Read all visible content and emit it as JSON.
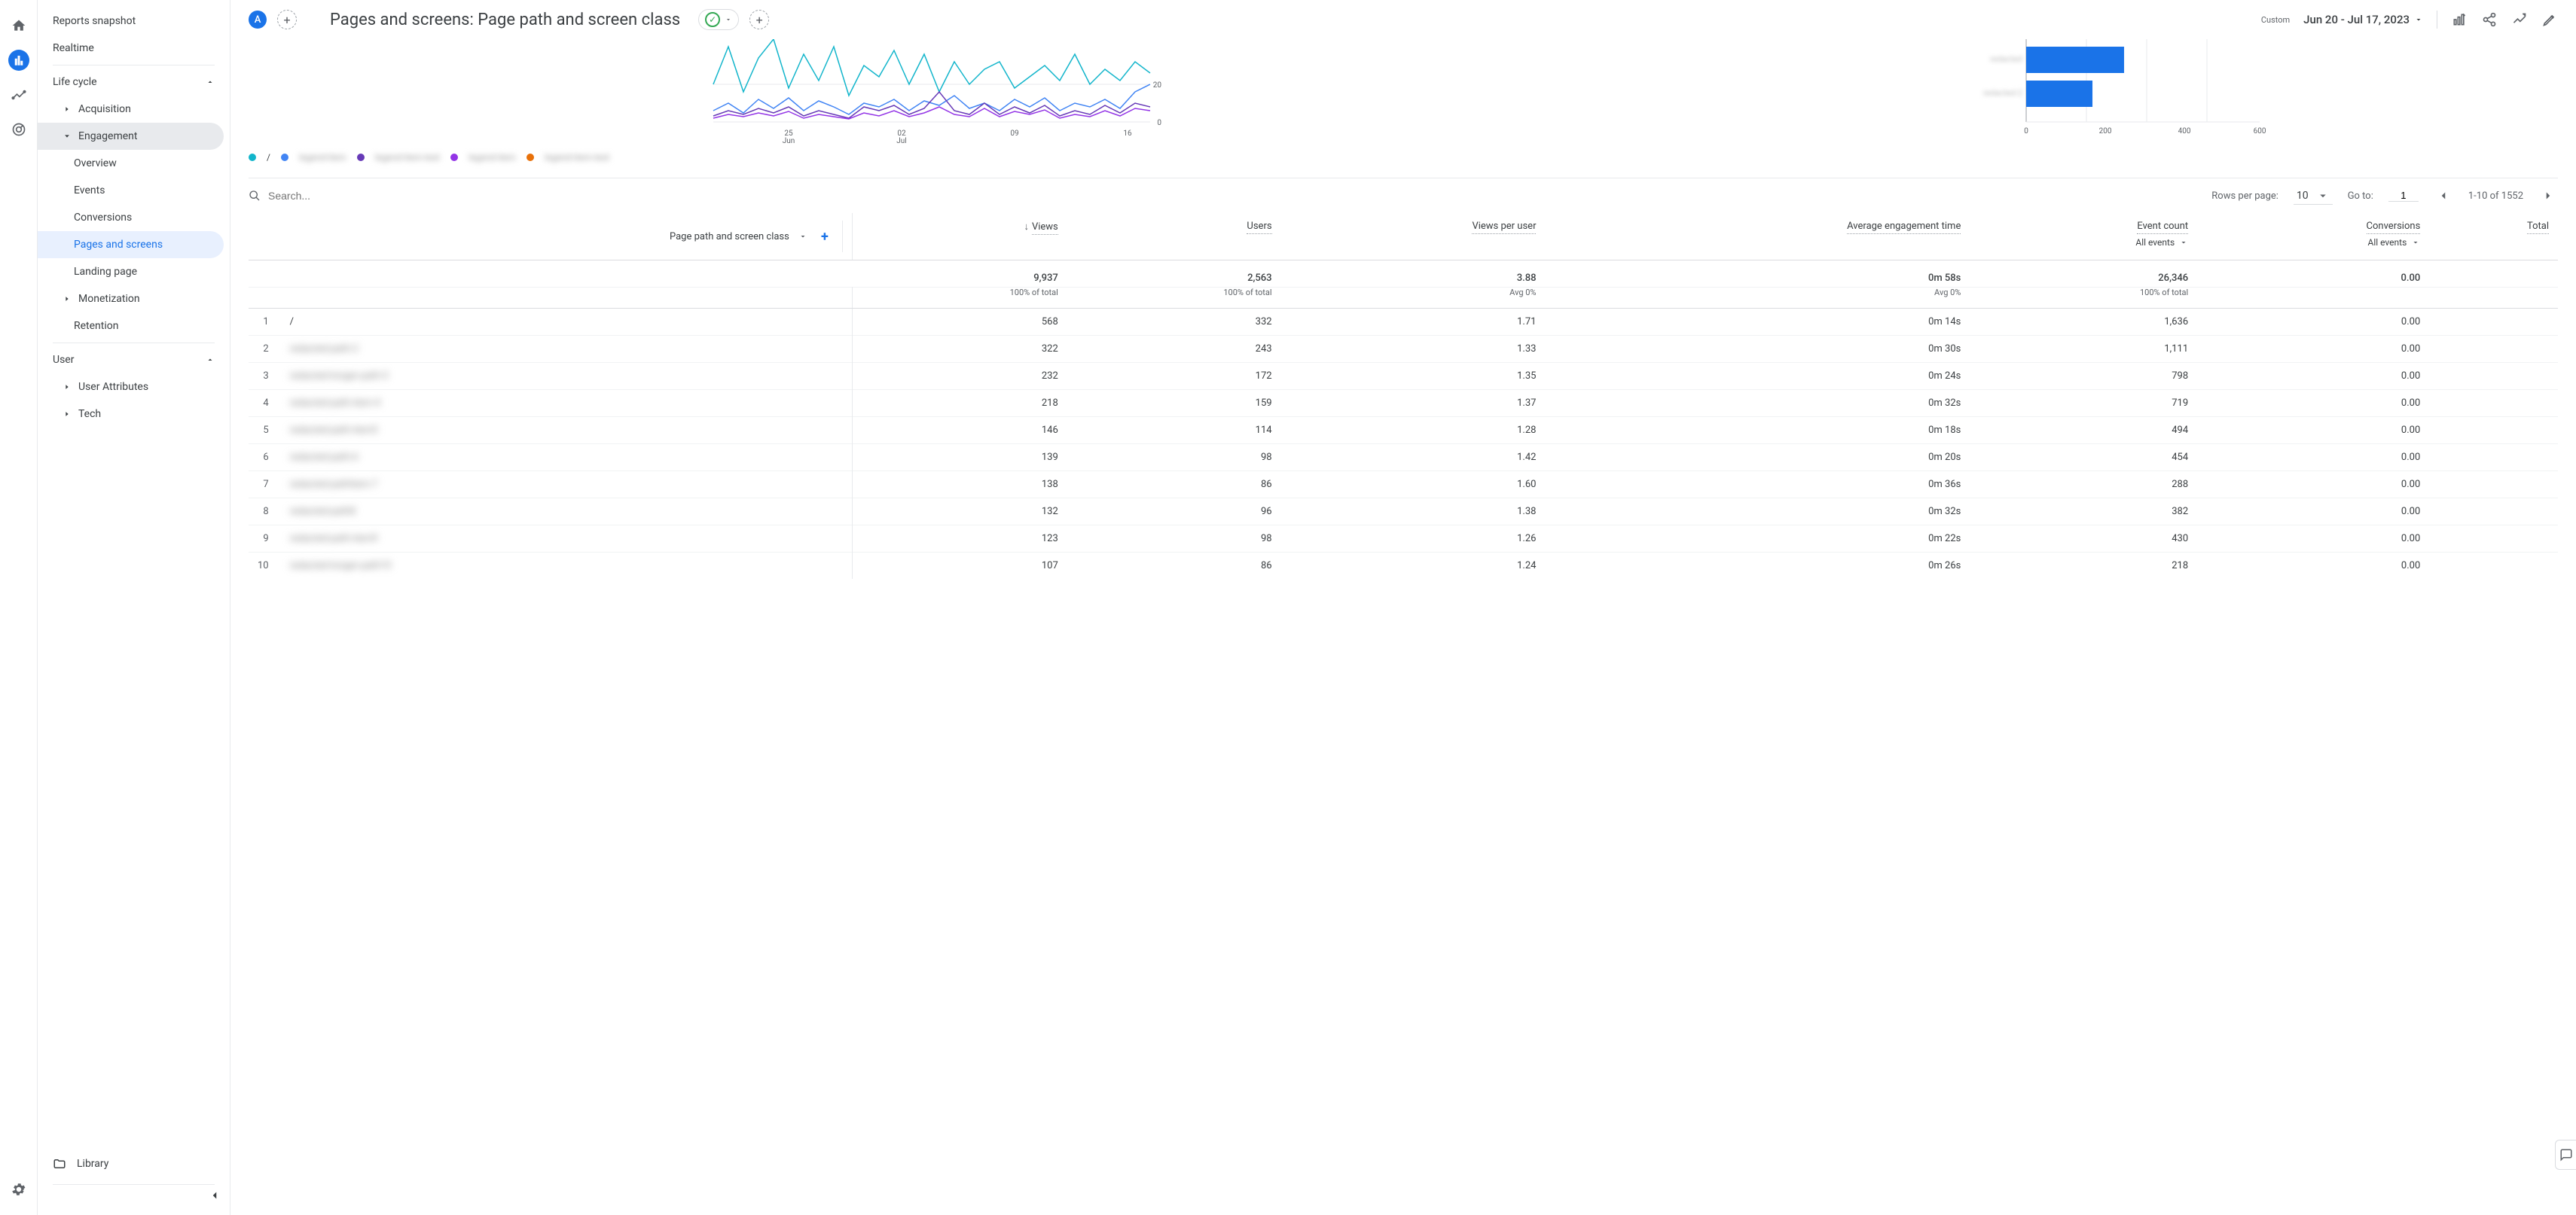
{
  "rail": {
    "avatar_letter": "A"
  },
  "sidebar": {
    "reports_snapshot": "Reports snapshot",
    "realtime": "Realtime",
    "life_cycle": "Life cycle",
    "acquisition": "Acquisition",
    "engagement": "Engagement",
    "engagement_items": {
      "overview": "Overview",
      "events": "Events",
      "conversions": "Conversions",
      "pages_screens": "Pages and screens",
      "landing_page": "Landing page"
    },
    "monetization": "Monetization",
    "retention": "Retention",
    "user": "User",
    "user_attributes": "User Attributes",
    "tech": "Tech",
    "library": "Library"
  },
  "header": {
    "title": "Pages and screens: Page path and screen class",
    "custom_label": "Custom",
    "date_range": "Jun 20 - Jul 17, 2023"
  },
  "chart_data": [
    {
      "type": "line",
      "series_count": 5,
      "x_ticks": [
        "25\nJun",
        "02\nJul",
        "09",
        "16"
      ],
      "y_ticks": [
        0,
        20
      ],
      "note": "5 overlapping line series (teal, light blue, purple, violet); values range approx 0-55 over Jun 20 - Jul 17",
      "legend_visible_label": "/"
    },
    {
      "type": "bar",
      "orientation": "horizontal",
      "x_ticks": [
        0,
        200,
        400,
        600
      ],
      "bars": [
        {
          "label": "(redacted)",
          "value": 260
        },
        {
          "label": "(redacted)",
          "value": 170
        }
      ],
      "color": "#1a73e8"
    }
  ],
  "search": {
    "placeholder": "Search..."
  },
  "pager": {
    "rows_label": "Rows per page:",
    "rows_value": "10",
    "goto_label": "Go to:",
    "goto_value": "1",
    "range": "1-10 of 1552"
  },
  "table": {
    "dim_header": "Page path and screen class",
    "columns": {
      "views": "Views",
      "users": "Users",
      "views_per_user": "Views per user",
      "avg_engagement": "Average engagement time",
      "event_count": "Event count",
      "conversions": "Conversions",
      "total": "Total",
      "all_events": "All events"
    },
    "summary": {
      "views": "9,937",
      "views_sub": "100% of total",
      "users": "2,563",
      "users_sub": "100% of total",
      "vpu": "3.88",
      "vpu_sub": "Avg 0%",
      "aet": "0m 58s",
      "aet_sub": "Avg 0%",
      "events": "26,346",
      "events_sub": "100% of total",
      "conv": "0.00"
    },
    "rows": [
      {
        "idx": "1",
        "path": "/",
        "path_blur": false,
        "views": "568",
        "users": "332",
        "vpu": "1.71",
        "aet": "0m 14s",
        "events": "1,636",
        "conv": "0.00"
      },
      {
        "idx": "2",
        "path": "redacted-path-2",
        "path_blur": true,
        "views": "322",
        "users": "243",
        "vpu": "1.33",
        "aet": "0m 30s",
        "events": "1,111",
        "conv": "0.00"
      },
      {
        "idx": "3",
        "path": "redacted-longer-path-3",
        "path_blur": true,
        "views": "232",
        "users": "172",
        "vpu": "1.35",
        "aet": "0m 24s",
        "events": "798",
        "conv": "0.00"
      },
      {
        "idx": "4",
        "path": "redacted-path-item-4",
        "path_blur": true,
        "views": "218",
        "users": "159",
        "vpu": "1.37",
        "aet": "0m 32s",
        "events": "719",
        "conv": "0.00"
      },
      {
        "idx": "5",
        "path": "redacted-path-item5",
        "path_blur": true,
        "views": "146",
        "users": "114",
        "vpu": "1.28",
        "aet": "0m 18s",
        "events": "494",
        "conv": "0.00"
      },
      {
        "idx": "6",
        "path": "redacted-path-6",
        "path_blur": true,
        "views": "139",
        "users": "98",
        "vpu": "1.42",
        "aet": "0m 20s",
        "events": "454",
        "conv": "0.00"
      },
      {
        "idx": "7",
        "path": "redacted-pathitem-7",
        "path_blur": true,
        "views": "138",
        "users": "86",
        "vpu": "1.60",
        "aet": "0m 36s",
        "events": "288",
        "conv": "0.00"
      },
      {
        "idx": "8",
        "path": "redacted-path8",
        "path_blur": true,
        "views": "132",
        "users": "96",
        "vpu": "1.38",
        "aet": "0m 32s",
        "events": "382",
        "conv": "0.00"
      },
      {
        "idx": "9",
        "path": "redacted-path-item9",
        "path_blur": true,
        "views": "123",
        "users": "98",
        "vpu": "1.26",
        "aet": "0m 22s",
        "events": "430",
        "conv": "0.00"
      },
      {
        "idx": "10",
        "path": "redacted-longer-path10",
        "path_blur": true,
        "views": "107",
        "users": "86",
        "vpu": "1.24",
        "aet": "0m 26s",
        "events": "218",
        "conv": "0.00"
      }
    ]
  }
}
